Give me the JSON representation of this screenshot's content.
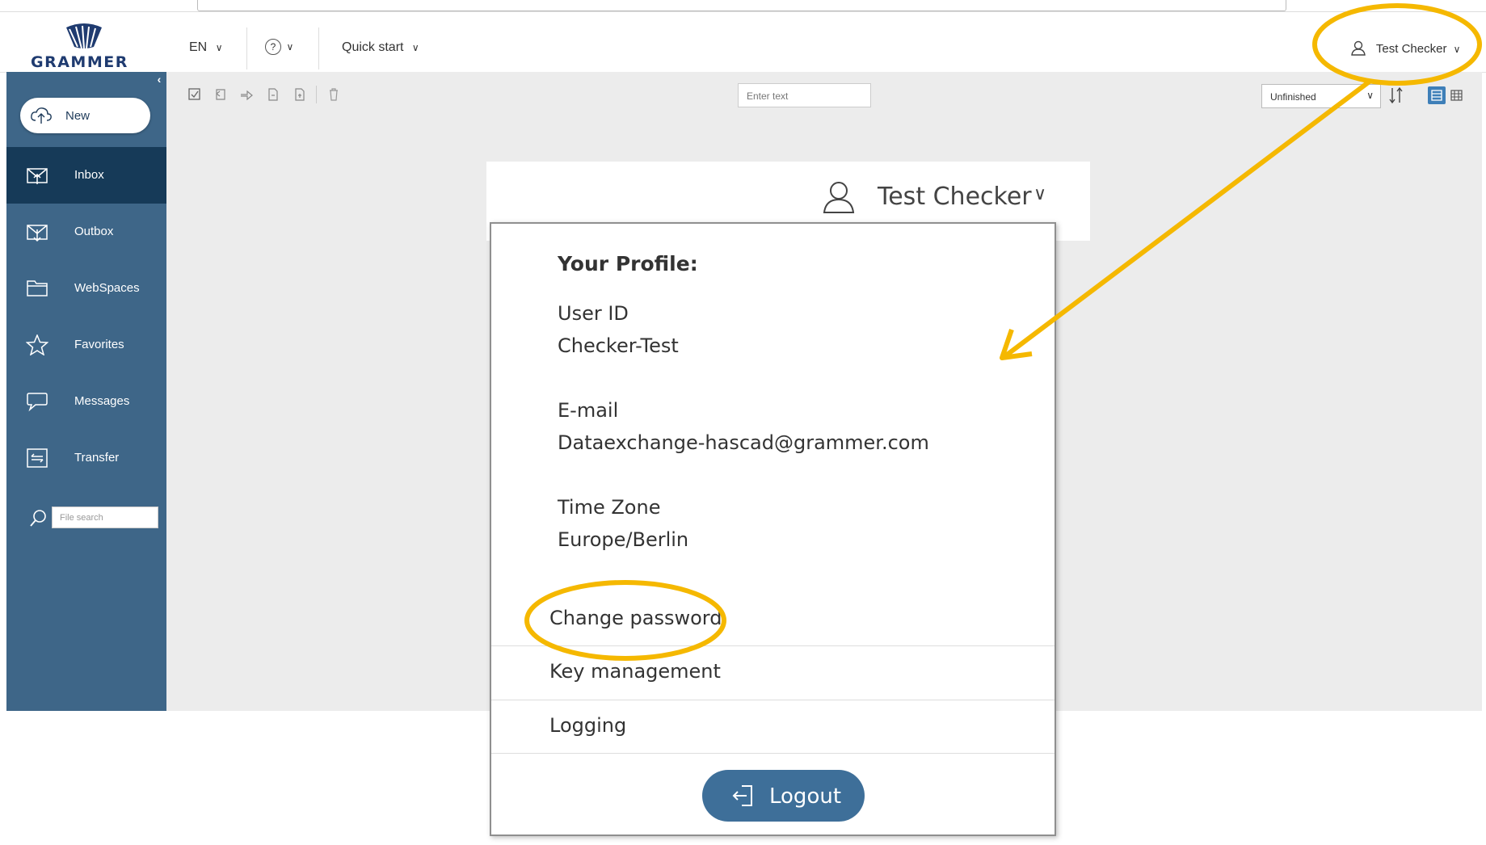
{
  "brand": {
    "logo_text": "GRAMMER"
  },
  "topbar": {
    "language": "EN",
    "help_icon": "help-circle-icon",
    "quick_start": "Quick start",
    "user_name": "Test Checker"
  },
  "sidebar": {
    "new_label": "New",
    "items": [
      {
        "label": "Inbox",
        "icon": "inbox-icon",
        "active": true
      },
      {
        "label": "Outbox",
        "icon": "outbox-icon",
        "active": false
      },
      {
        "label": "WebSpaces",
        "icon": "folder-icon",
        "active": false
      },
      {
        "label": "Favorites",
        "icon": "star-icon",
        "active": false
      },
      {
        "label": "Messages",
        "icon": "chat-icon",
        "active": false
      },
      {
        "label": "Transfer",
        "icon": "transfer-icon",
        "active": false
      }
    ],
    "file_search_placeholder": "File search"
  },
  "toolbar": {
    "search_placeholder": "Enter text",
    "filter_value": "Unfinished"
  },
  "profile_popup": {
    "user_name": "Test Checker",
    "heading": "Your Profile:",
    "user_id_label": "User ID",
    "user_id_value": "Checker-Test",
    "email_label": "E-mail",
    "email_value": "Dataexchange-hascad@grammer.com",
    "timezone_label": "Time Zone",
    "timezone_value": "Europe/Berlin",
    "change_password": "Change password",
    "key_management": "Key management",
    "logging": "Logging",
    "logout": "Logout"
  },
  "colors": {
    "sidebar": "#3e6688",
    "sidebar_active": "#163a58",
    "brand": "#1f3b70",
    "logout_button": "#3e6f99",
    "highlight": "#f5b800"
  }
}
